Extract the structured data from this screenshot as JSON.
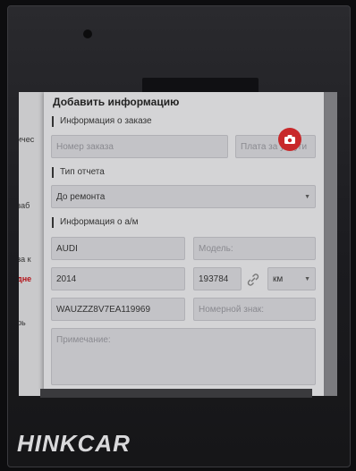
{
  "dialog": {
    "title": "Добавить информацию",
    "order_section": "Информация о заказе",
    "order_number_placeholder": "Номер заказа",
    "service_fee_placeholder": "Плата за услуги",
    "report_type_section": "Тип отчета",
    "report_type_value": "До ремонта",
    "vehicle_section": "Информация о а/м",
    "make_value": "AUDI",
    "model_placeholder": "Модель:",
    "year_value": "2014",
    "mileage_value": "193784",
    "mileage_unit": "км",
    "vin_value": "WAUZZZ8V7EA119969",
    "plate_placeholder": "Номерной знак:",
    "notes_placeholder": "Примечание:"
  },
  "background_fragments": [
    "ичес",
    "заб",
    "за к",
    "дне",
    "рь"
  ],
  "brand_text": "HINKCAR",
  "colors": {
    "accent_red": "#c8282a",
    "dialog_bg": "#d4d4d6"
  }
}
